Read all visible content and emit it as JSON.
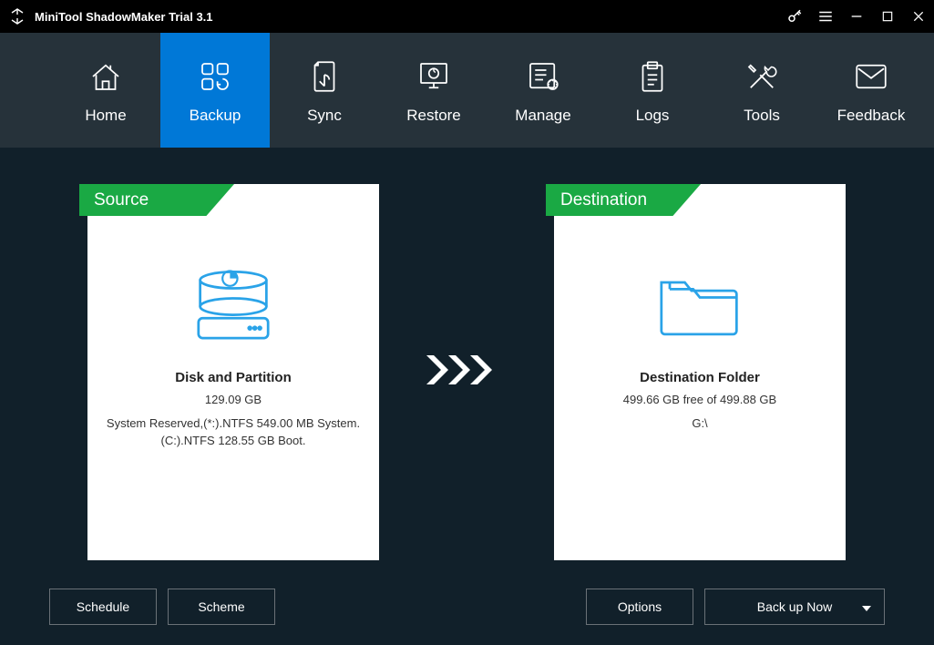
{
  "titlebar": {
    "title": "MiniTool ShadowMaker Trial 3.1"
  },
  "nav": {
    "items": [
      {
        "label": "Home"
      },
      {
        "label": "Backup"
      },
      {
        "label": "Sync"
      },
      {
        "label": "Restore"
      },
      {
        "label": "Manage"
      },
      {
        "label": "Logs"
      },
      {
        "label": "Tools"
      },
      {
        "label": "Feedback"
      }
    ],
    "active_index": 1
  },
  "source": {
    "tab": "Source",
    "heading": "Disk and Partition",
    "size": "129.09 GB",
    "detail1": "System Reserved,(*:).NTFS 549.00 MB System.",
    "detail2": "(C:).NTFS 128.55 GB Boot."
  },
  "destination": {
    "tab": "Destination",
    "heading": "Destination Folder",
    "free": "499.66 GB free of 499.88 GB",
    "path": "G:\\"
  },
  "buttons": {
    "schedule": "Schedule",
    "scheme": "Scheme",
    "options": "Options",
    "backup_now": "Back up Now"
  }
}
